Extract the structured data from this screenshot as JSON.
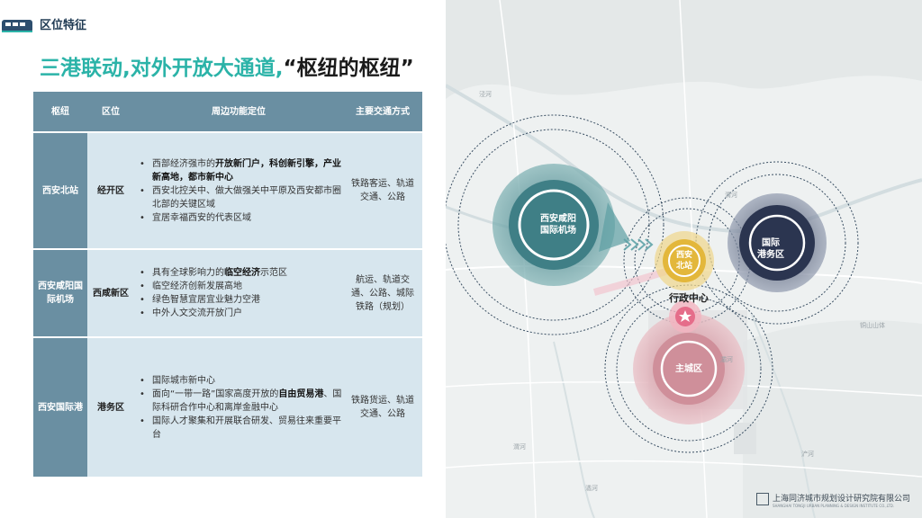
{
  "header": {
    "section_title": "区位特征",
    "headline_part1": "三港联动,对外开放大通道,",
    "headline_part2": "“枢纽的枢纽”"
  },
  "table": {
    "headers": [
      "枢纽",
      "区位",
      "周边功能定位",
      "主要交通方式"
    ],
    "rows": [
      {
        "hub": "西安北站",
        "zone": "经开区",
        "functions": [
          [
            "西部经济强市的",
            "开放新门户，科创新引擎，产业新高地，都市新中心",
            ""
          ],
          [
            "西安北控关中、做大做强关中平原及西安都市圈北部的关键区域",
            "",
            ""
          ],
          [
            "宜居幸福西安的代表区域",
            "",
            ""
          ]
        ],
        "transport": "铁路客运、轨道交通、公路"
      },
      {
        "hub": "西安咸阳国际机场",
        "zone": "西咸新区",
        "functions": [
          [
            "具有全球影响力的",
            "临空经济",
            "示范区"
          ],
          [
            "临空经济创新发展高地",
            "",
            ""
          ],
          [
            "绿色智慧宜居宜业魅力空港",
            "",
            ""
          ],
          [
            "中外人文交流开放门户",
            "",
            ""
          ]
        ],
        "transport": "航运、轨道交通、公路、城际铁路（规划）"
      },
      {
        "hub": "西安国际港",
        "zone": "港务区",
        "functions": [
          [
            "国际城市新中心",
            "",
            ""
          ],
          [
            "面向“一带一路”国家高度开放的",
            "自由贸易港",
            "、国际科研合作中心和离岸金融中心"
          ],
          [
            "国际人才聚集和开展联合研发、贸易往来重要平台",
            "",
            ""
          ]
        ],
        "transport": "铁路货运、轨道交通、公路"
      }
    ]
  },
  "map": {
    "nodes": {
      "airport": "西安咸阳\n国际机场",
      "north_station": "西安\n北站",
      "port": "国际\n港务区",
      "city": "主城区"
    },
    "admin_center": "行政中心",
    "labels": [
      "泾河",
      "渭河",
      "灞河",
      "浐河",
      "潏河",
      "铜山山体",
      "渭河"
    ]
  },
  "footer": {
    "company": "上海同济城市规划设计研究院有限公司",
    "company_en": "SHANGHAI TONGJI URBAN PLANNING & DESIGN INSTITUTE CO.,LTD."
  },
  "colors": {
    "teal": "#2bb3a8",
    "table_header": "#6a8fa2",
    "table_body": "#d7e6ee",
    "airport": "#3f7f86",
    "north_station": "#e3b73b",
    "port": "#2b3550",
    "city": "#c98b96"
  }
}
